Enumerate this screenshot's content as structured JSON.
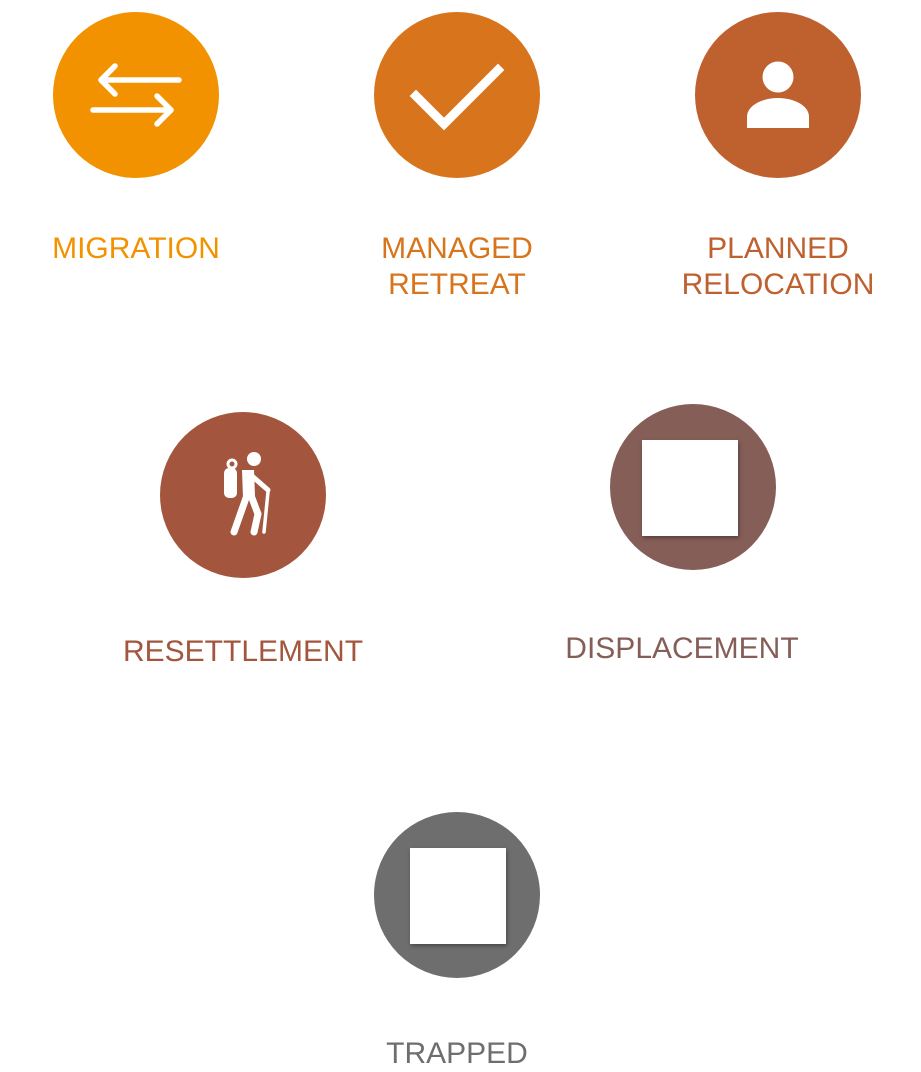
{
  "colors": {
    "migration": "#f39200",
    "managed_retreat": "#d8741c",
    "planned_relocation": "#bf602f",
    "resettlement": "#a3563d",
    "displacement": "#865e58",
    "trapped": "#6e6e6e"
  },
  "icons": {
    "migration": "swap-arrows-icon",
    "managed_retreat": "checkmark-icon",
    "planned_relocation": "person-icon",
    "resettlement": "hiker-icon",
    "displacement": "white-square-icon",
    "trapped": "white-square-icon"
  },
  "labels": {
    "migration": [
      "MIGRATION"
    ],
    "managed_retreat": [
      "MANAGED",
      "RETREAT"
    ],
    "planned_relocation": [
      "PLANNED",
      "RELOCATION"
    ],
    "resettlement": [
      "RESETTLEMENT"
    ],
    "displacement": [
      "DISPLACEMENT"
    ],
    "trapped": [
      "TRAPPED"
    ]
  }
}
